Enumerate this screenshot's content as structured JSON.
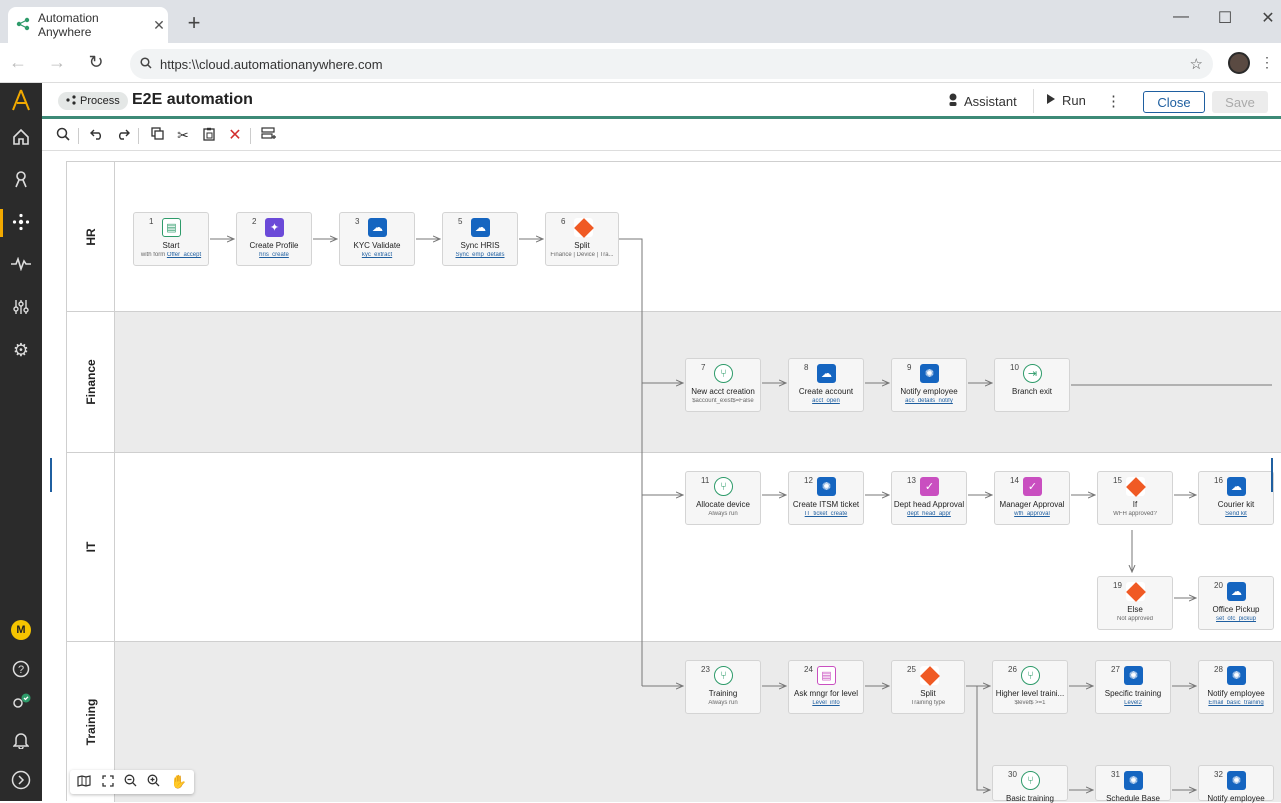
{
  "browser": {
    "tab_title": "Automation Anywhere",
    "tab_close": "✕",
    "new_tab": "+",
    "url": "https:\\\\cloud.automationanywhere.com",
    "window_minimize": "—",
    "window_maximize": "☐",
    "window_close": "✕"
  },
  "header": {
    "chip_label": "Process",
    "title": "E2E automation",
    "assistant_label": "Assistant",
    "run_label": "Run",
    "close_label": "Close",
    "save_label": "Save"
  },
  "leftnav": {
    "user_initial": "M",
    "accent_color": "#f2a900"
  },
  "lanes": [
    {
      "label": "HR"
    },
    {
      "label": "Finance"
    },
    {
      "label": "IT"
    },
    {
      "label": "Training"
    }
  ],
  "nodes": [
    {
      "num": "1",
      "title": "Start",
      "sub_prefix": "with form ",
      "sub": "Offer_accept",
      "icon": "form-icon"
    },
    {
      "num": "2",
      "title": "Create Profile",
      "sub": "hris_create",
      "icon": "ai-sparkle-icon"
    },
    {
      "num": "3",
      "title": "KYC Validate",
      "sub": "kyc_extract",
      "icon": "cloud-bot-icon"
    },
    {
      "num": "5",
      "title": "Sync HRIS",
      "sub": "Sync_emp_details",
      "icon": "cloud-bot-icon"
    },
    {
      "num": "6",
      "title": "Split",
      "sub": "Finance | Device | Tra...",
      "icon": "split-icon"
    },
    {
      "num": "7",
      "title": "New acct creation",
      "sub": "$account_exist$=False",
      "icon": "branch-icon"
    },
    {
      "num": "8",
      "title": "Create account",
      "sub": "acct_open",
      "icon": "cloud-bot-icon"
    },
    {
      "num": "9",
      "title": "Notify employee",
      "sub": "acc_details_notify",
      "icon": "bot-icon"
    },
    {
      "num": "10",
      "title": "Branch exit",
      "sub": "",
      "icon": "exit-icon"
    },
    {
      "num": "11",
      "title": "Allocate device",
      "sub": "Always run",
      "icon": "branch-icon"
    },
    {
      "num": "12",
      "title": "Create ITSM ticket",
      "sub": "IT_ticket_create",
      "icon": "bot-icon"
    },
    {
      "num": "13",
      "title": "Dept head Approval",
      "sub": "dept_head_appr",
      "icon": "approval-icon"
    },
    {
      "num": "14",
      "title": "Manager Approval",
      "sub": "wfh_approval",
      "icon": "approval-icon"
    },
    {
      "num": "15",
      "title": "If",
      "sub": "WFH approved?",
      "icon": "if-icon"
    },
    {
      "num": "16",
      "title": "Courier kit",
      "sub": "Send kit",
      "icon": "cloud-bot-icon"
    },
    {
      "num": "19",
      "title": "Else",
      "sub": "Not approved",
      "icon": "else-icon"
    },
    {
      "num": "20",
      "title": "Office Pickup",
      "sub": "set_ofc_pickup",
      "icon": "cloud-bot-icon"
    },
    {
      "num": "23",
      "title": "Training",
      "sub": "Always run",
      "icon": "branch-icon"
    },
    {
      "num": "24",
      "title": "Ask mngr for level",
      "sub": "Level_info",
      "icon": "form-icon"
    },
    {
      "num": "25",
      "title": "Split",
      "sub": "Training type",
      "icon": "split-icon"
    },
    {
      "num": "26",
      "title": "Higher level traini...",
      "sub": "$level$ >=1",
      "icon": "branch-icon"
    },
    {
      "num": "27",
      "title": "Specific training",
      "sub": "Level2",
      "icon": "bot-icon"
    },
    {
      "num": "28",
      "title": "Notify employee",
      "sub": "Email_basic_training",
      "icon": "bot-icon"
    },
    {
      "num": "30",
      "title": "Basic training",
      "sub": "",
      "icon": "branch-icon"
    },
    {
      "num": "31",
      "title": "Schedule Base",
      "sub": "",
      "icon": "bot-icon"
    },
    {
      "num": "32",
      "title": "Notify employee",
      "sub": "",
      "icon": "bot-icon"
    }
  ]
}
